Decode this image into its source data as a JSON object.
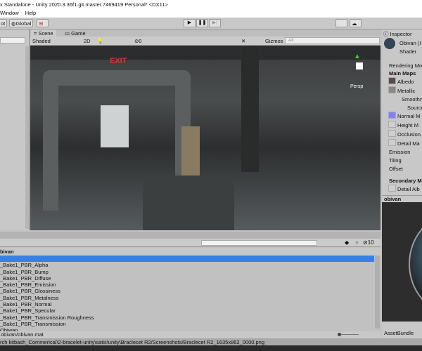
{
  "window": {
    "title": "x Standalone - Unity 2020.3.36f1.git.master.7469419 Personal* <DX11>"
  },
  "menu": [
    "Window",
    "Help"
  ],
  "toolbar": {
    "pivot": "ot",
    "global": "Global",
    "play": "▶",
    "pause": "❚❚",
    "step": "▶|"
  },
  "scene": {
    "tabs": [
      "Scene",
      "Game"
    ],
    "shading": "Shaded",
    "mode2d": "2D",
    "hidden_count": "0",
    "gizmos": "Gizmos",
    "search_placeholder": "All",
    "persp": "Persp",
    "exit_sign": "EXIT"
  },
  "inspector": {
    "tab": "Inspector",
    "name": "Obivan (I",
    "shader": "Shader",
    "rendering_mode": "Rendering Mod",
    "main_maps": "Main Maps",
    "albedo": "Albedo",
    "metallic": "Metallic",
    "smoothness": "Smoothn",
    "source": "Source",
    "normal": "Normal M",
    "height": "Height M",
    "occlusion": "Occlusion",
    "detail_mask": "Detail Ma",
    "emission": "Emission",
    "tiling": "Tiling",
    "offset": "Offset",
    "secondary": "Secondary Ma",
    "detail_albedo": "Detail Alb",
    "normal_color": "#8080ff"
  },
  "preview": {
    "title": "obivan",
    "assetbundle": "AssetBundle"
  },
  "project": {
    "hidden_count": "10",
    "breadcrumb": "bivan",
    "items": [
      "",
      "_Bake1_PBR_Alpha",
      "_Bake1_PBR_Bump",
      "_Bake1_PBR_Diffuse",
      "_Bake1_PBR_Emission",
      "_Bake1_PBR_Glossiness",
      "_Bake1_PBR_Metalness",
      "_Bake1_PBR_Normal",
      "_Bake1_PBR_Specular",
      "_Bake1_PBR_Transmission Roughness",
      "_Bake1_PBR_Transmission",
      "Obiwan"
    ],
    "selected_index": 0,
    "path": "obivan/obivan.mat"
  },
  "status": {
    "text": "rch kitbash_Commerical\\2-bracelet-unity\\satis\\unity\\Braclecet R2/Screenshots/Braclecet R2_1635x862_0000.png"
  },
  "colors": {
    "selection": "#3a7de8",
    "exit": "#e0322b"
  }
}
